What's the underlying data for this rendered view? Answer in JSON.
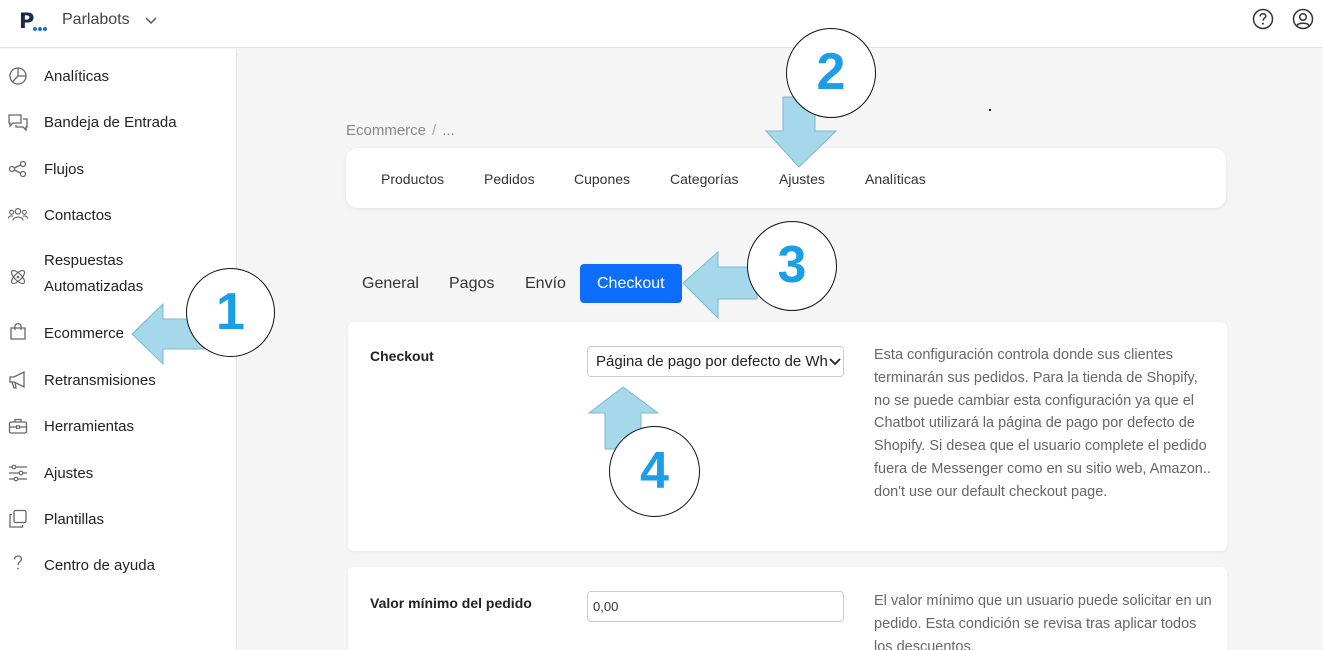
{
  "app": {
    "workspace_name": "Parlabots",
    "logo_letter": "P",
    "brand_color": "#1b2a4a",
    "accent_color": "#0d6efd",
    "annotation_color": "#1a9ee6",
    "arrow_color": "#a5d8ea"
  },
  "header_icons": [
    "help-circle-icon",
    "user-circle-icon"
  ],
  "sidebar": {
    "items": [
      {
        "label": "Analíticas",
        "icon": "pie-chart-icon"
      },
      {
        "label": "Bandeja de Entrada",
        "icon": "chat-bubbles-icon"
      },
      {
        "label": "Flujos",
        "icon": "flow-nodes-icon"
      },
      {
        "label": "Contactos",
        "icon": "people-icon"
      },
      {
        "label": "Respuestas",
        "label2": "Automatizadas",
        "icon": "atom-icon"
      },
      {
        "label": "Ecommerce",
        "icon": "shopping-bag-icon"
      },
      {
        "label": "Retransmisiones",
        "icon": "megaphone-icon"
      },
      {
        "label": "Herramientas",
        "icon": "toolbox-icon"
      },
      {
        "label": "Ajustes",
        "icon": "sliders-icon"
      },
      {
        "label": "Plantillas",
        "icon": "copy-icon"
      },
      {
        "label": "Centro de ayuda",
        "icon": "question-icon"
      }
    ]
  },
  "breadcrumb": {
    "root": "Ecommerce",
    "sep": "/",
    "current": "..."
  },
  "main_tabs": [
    "Productos",
    "Pedidos",
    "Cupones",
    "Categorías",
    "Ajustes",
    "Analíticas"
  ],
  "sub_tabs": [
    "General",
    "Pagos",
    "Envío",
    "Checkout"
  ],
  "active_sub_tab": "Checkout",
  "checkout_card": {
    "label": "Checkout",
    "select_value": "Página de pago por defecto de WhatsApp",
    "description": "Esta configuración controla donde sus clientes terminarán sus pedidos. Para la tienda de Shopify, no se puede cambiar esta configuración ya que el Chatbot utilizará la página de pago por defecto de Shopify. Si desea que el usuario complete el pedido fuera de Messenger como en su sitio web, Amazon.. don't use our default checkout page."
  },
  "min_order_card": {
    "label": "Valor mínimo del pedido",
    "input_value": "0,00",
    "description": "El valor mínimo que un usuario puede solicitar en un pedido. Esta condición se revisa tras aplicar todos los descuentos."
  },
  "annotations": [
    "1",
    "2",
    "3",
    "4"
  ]
}
